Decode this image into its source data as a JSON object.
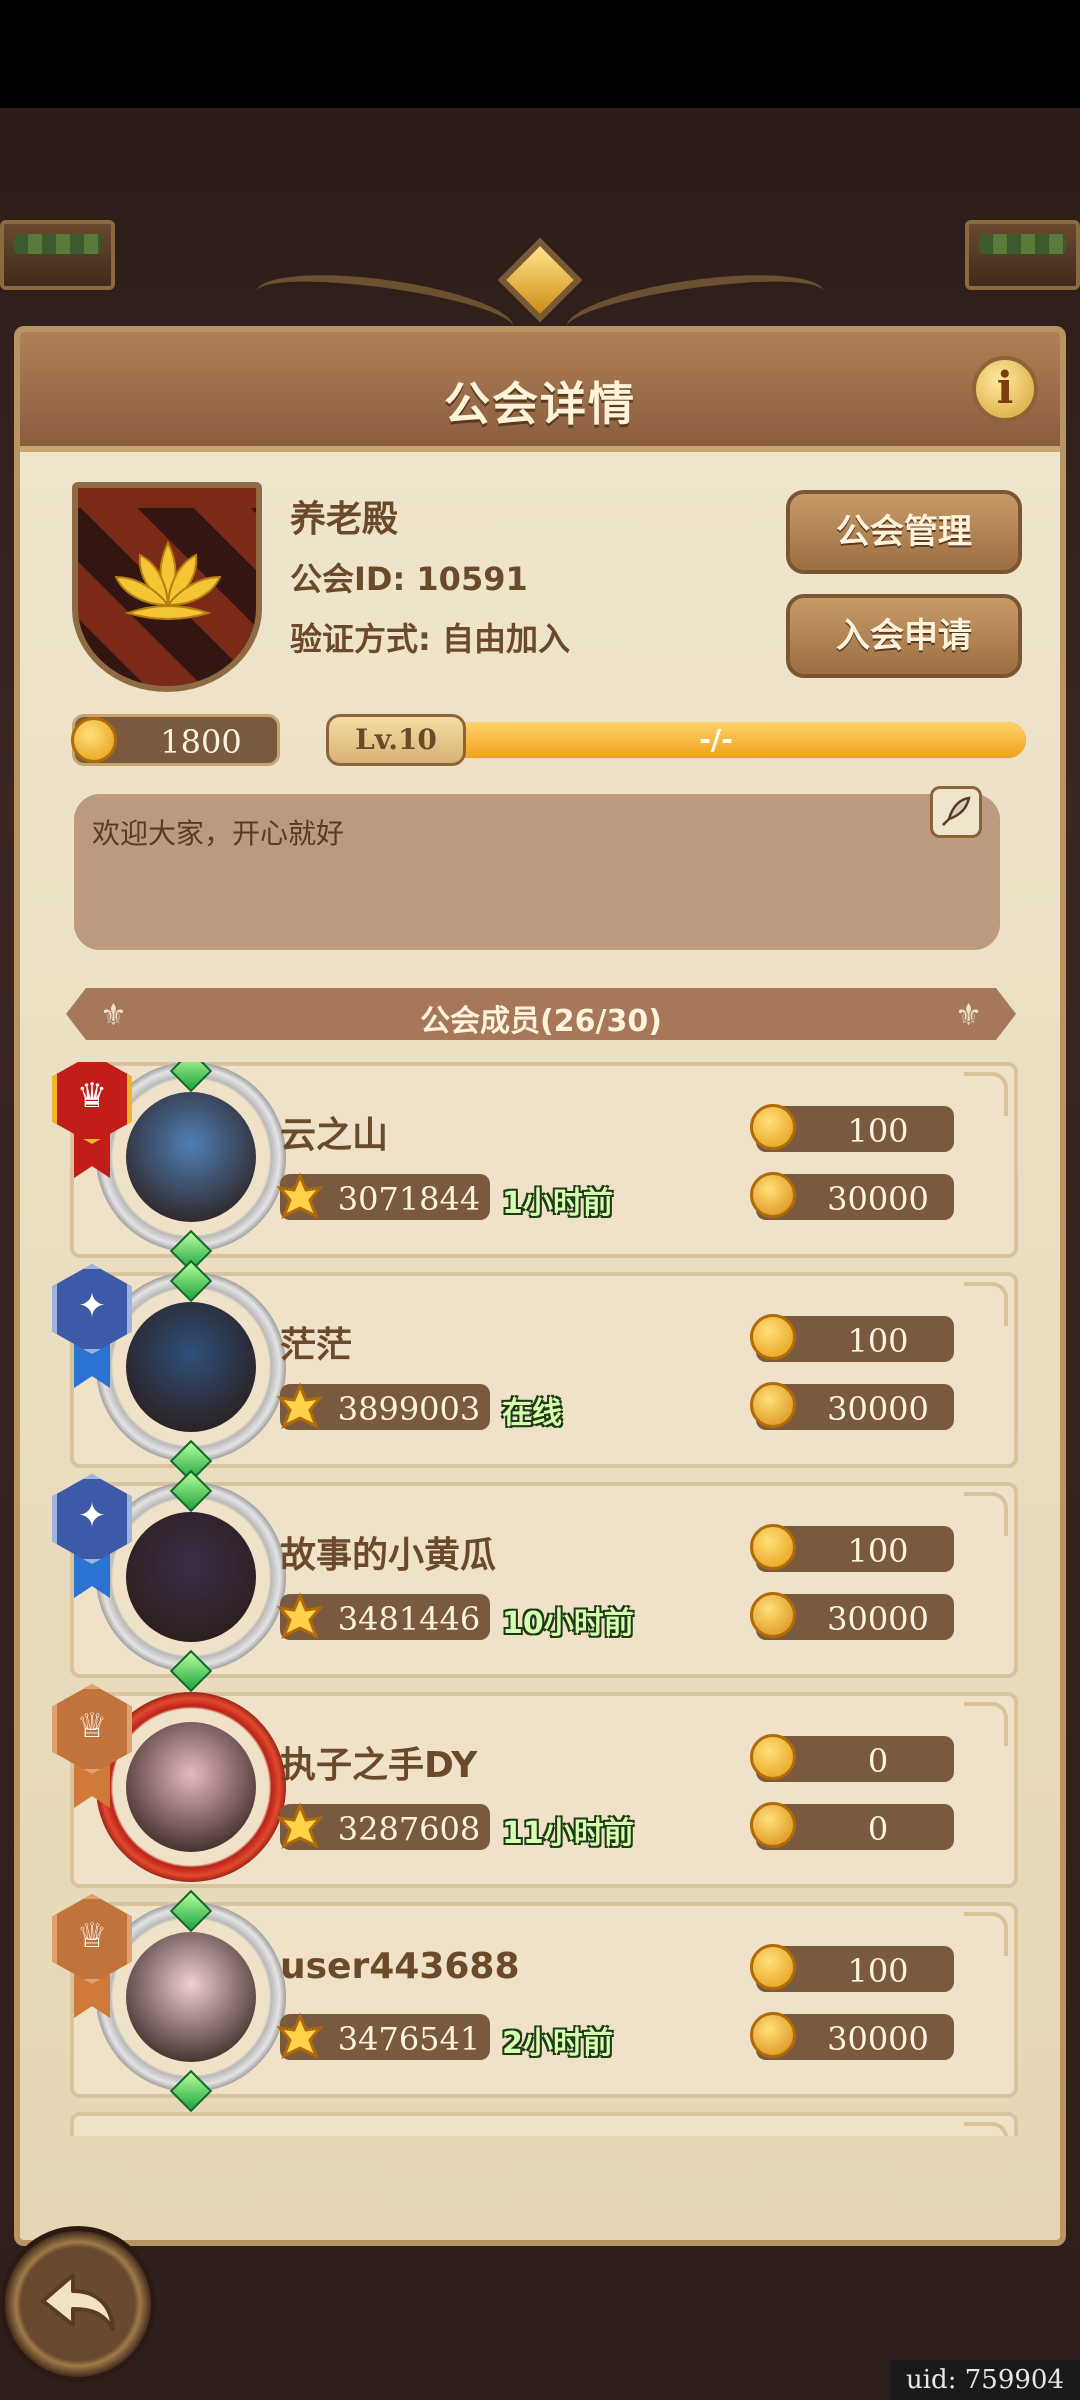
{
  "header": {
    "title": "公会详情",
    "info_icon": "i"
  },
  "guild": {
    "name": "养老殿",
    "id_label": "公会ID: 10591",
    "verify_label": "验证方式: 自由加入",
    "coins": "1800",
    "level": "Lv.10",
    "level_progress_text": "-/-",
    "level_progress": 1.0,
    "notice": "欢迎大家，开心就好"
  },
  "buttons": {
    "manage": "公会管理",
    "apply": "入会申请"
  },
  "members_title": "公会成员(26/30)",
  "members": [
    {
      "name": "云之山",
      "power": "3071844",
      "status": "1小时前",
      "contribution": "100",
      "honor": "30000",
      "rank": "leader"
    },
    {
      "name": "茫茫",
      "power": "3899003",
      "status": "在线",
      "contribution": "100",
      "honor": "30000",
      "rank": "elite"
    },
    {
      "name": "故事的小黄瓜",
      "power": "3481446",
      "status": "10小时前",
      "contribution": "100",
      "honor": "30000",
      "rank": "elite"
    },
    {
      "name": "执子之手DY",
      "power": "3287608",
      "status": "11小时前",
      "contribution": "0",
      "honor": "0",
      "rank": "member"
    },
    {
      "name": "user443688",
      "power": "3476541",
      "status": "2小时前",
      "contribution": "100",
      "honor": "30000",
      "rank": "member"
    }
  ],
  "footer": {
    "uid": "uid: 759904"
  },
  "colors": {
    "panel": "#ece1c6",
    "accent": "#f0a21e",
    "status_text": "#d7ffb2"
  }
}
